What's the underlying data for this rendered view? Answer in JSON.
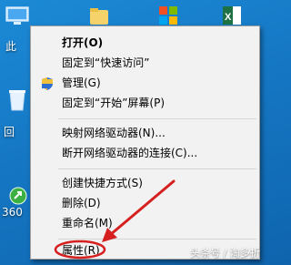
{
  "desktop": {
    "labels": [
      "此",
      "回",
      "360"
    ]
  },
  "menu": {
    "items": [
      {
        "label": "打开(O)",
        "bold": true
      },
      {
        "label": "固定到“快速访问”"
      },
      {
        "label": "管理(G)",
        "icon": "shield-icon"
      },
      {
        "label": "固定到“开始”屏幕(P)"
      },
      {
        "label": "映射网络驱动器(N)..."
      },
      {
        "label": "断开网络驱动器的连接(C)..."
      },
      {
        "label": "创建快捷方式(S)"
      },
      {
        "label": "删除(D)"
      },
      {
        "label": "重命名(M)"
      },
      {
        "label": "属性(R)"
      }
    ]
  },
  "annotation": {
    "color": "#d62020"
  },
  "watermark": "头条号 / 淘多折"
}
